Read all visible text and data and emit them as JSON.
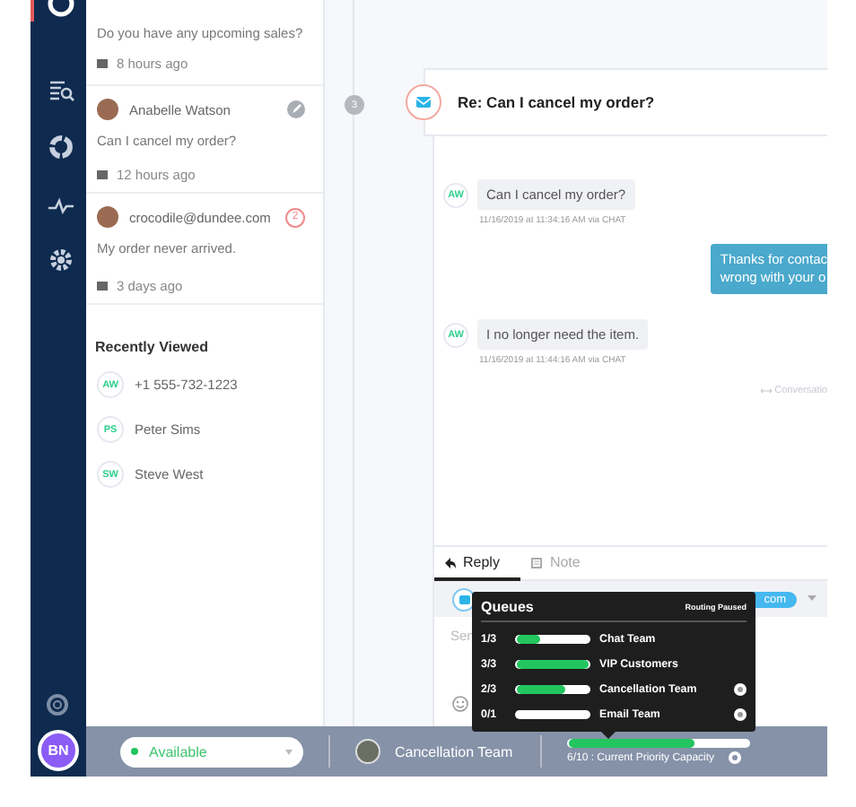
{
  "nav": {
    "items": [
      {
        "selected": true
      },
      {
        "selected": false
      },
      {
        "selected": false
      },
      {
        "selected": false
      },
      {
        "selected": false
      }
    ],
    "user_initials": "BN"
  },
  "conversations": [
    {
      "preview": "Do you have any upcoming sales?",
      "time": "8 hours ago"
    },
    {
      "name": "Anabelle Watson",
      "preview": "Can I cancel my order?",
      "time": "12 hours ago",
      "assigned": true
    },
    {
      "name": "crocodile@dundee.com",
      "preview": "My order never arrived.",
      "time": "3 days ago",
      "badge": "2"
    }
  ],
  "recently_viewed": {
    "title": "Recently Viewed",
    "items": [
      {
        "initials": "AW",
        "label": "+1 555-732-1223"
      },
      {
        "initials": "PS",
        "label": "Peter Sims"
      },
      {
        "initials": "SW",
        "label": "Steve West"
      }
    ]
  },
  "conversation": {
    "step": "3",
    "subject": "Re: Can I cancel my order?",
    "messages": [
      {
        "kind": "customer",
        "initials": "AW",
        "text": "Can I cancel my order?",
        "meta": "11/16/2019 at 11:34:16 AM via CHAT"
      },
      {
        "kind": "agent",
        "lines": [
          "Thanks for contac",
          "wrong with your o"
        ]
      },
      {
        "kind": "customer",
        "initials": "AW",
        "text": "I no longer need the item.",
        "meta": "11/16/2019 at 11:44:16 AM via CHAT"
      },
      {
        "kind": "note",
        "text": "Conversatio"
      }
    ]
  },
  "reply": {
    "tabs": [
      {
        "label": "Reply",
        "selected": true
      },
      {
        "label": "Note",
        "selected": false
      }
    ],
    "recipient": "com",
    "placeholder": "Sen"
  },
  "queues": {
    "title": "Queues",
    "status": "Routing Paused",
    "rows": [
      {
        "count": "1/3",
        "level": 0.33,
        "name": "Chat Team",
        "alert": false
      },
      {
        "count": "3/3",
        "level": 1,
        "name": "VIP Customers",
        "alert": false
      },
      {
        "count": "2/3",
        "level": 0.67,
        "name": "Cancellation Team",
        "alert": true
      },
      {
        "count": "0/1",
        "level": 0,
        "name": "Email Team",
        "alert": true
      }
    ]
  },
  "status_bar": {
    "status": {
      "label": "Available",
      "online": true
    },
    "team": "Cancellation Team",
    "capacity": {
      "level": 0.7,
      "label": "6/10 : Current Priority Capacity"
    }
  }
}
